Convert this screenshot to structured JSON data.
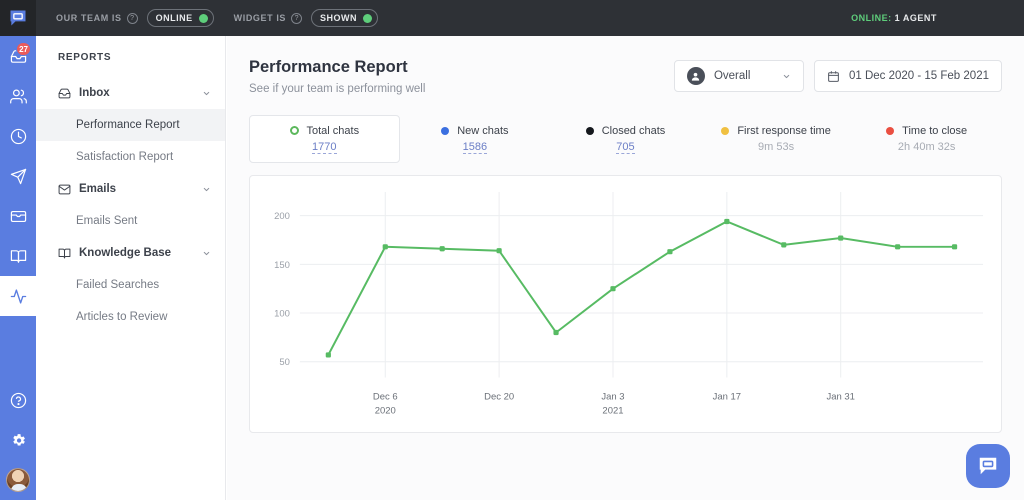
{
  "topbar": {
    "team_label": "OUR TEAM IS",
    "team_status": "ONLINE",
    "widget_label": "WIDGET IS",
    "widget_status": "SHOWN",
    "online_text": "ONLINE:",
    "agent_text": "1 AGENT",
    "help_glyph": "?",
    "online_color": "#5ece7b"
  },
  "rail": {
    "inbox_badge": "27",
    "items": [
      {
        "icon": "inbox-icon"
      },
      {
        "icon": "users-icon"
      },
      {
        "icon": "clock-icon"
      },
      {
        "icon": "paper-plane-icon"
      },
      {
        "icon": "archive-icon"
      },
      {
        "icon": "book-icon"
      },
      {
        "icon": "activity-icon"
      }
    ],
    "bottom": [
      {
        "icon": "help-circle-icon"
      },
      {
        "icon": "gear-icon"
      },
      {
        "icon": "avatar"
      }
    ]
  },
  "sidebar": {
    "title": "REPORTS",
    "groups": [
      {
        "label": "Inbox",
        "icon": "inbox-icon",
        "chevron": "chevron-down-icon",
        "items": [
          {
            "label": "Performance Report",
            "active": true
          },
          {
            "label": "Satisfaction Report",
            "active": false
          }
        ]
      },
      {
        "label": "Emails",
        "icon": "envelope-icon",
        "chevron": "chevron-down-icon",
        "items": [
          {
            "label": "Emails Sent",
            "active": false
          }
        ]
      },
      {
        "label": "Knowledge Base",
        "icon": "book-icon",
        "chevron": "chevron-down-icon",
        "items": [
          {
            "label": "Failed Searches",
            "active": false
          },
          {
            "label": "Articles to Review",
            "active": false
          }
        ]
      }
    ]
  },
  "header": {
    "title": "Performance Report",
    "subtitle": "See if your team is performing well",
    "scope_value": "Overall",
    "date_range": "01 Dec 2020 - 15 Feb 2021"
  },
  "metrics": [
    {
      "label": "Total chats",
      "value": "1770",
      "color": "#5cb85c",
      "active": true,
      "link": true,
      "marker": "ring"
    },
    {
      "label": "New chats",
      "value": "1586",
      "color": "#3b6fe0",
      "active": false,
      "link": true,
      "marker": "dot"
    },
    {
      "label": "Closed chats",
      "value": "705",
      "color": "#15181d",
      "active": false,
      "link": true,
      "marker": "dot"
    },
    {
      "label": "First response time",
      "value": "9m 53s",
      "color": "#f0c041",
      "active": false,
      "link": false,
      "marker": "dot"
    },
    {
      "label": "Time to close",
      "value": "2h 40m 32s",
      "color": "#ea4f41",
      "active": false,
      "link": false,
      "marker": "dot"
    }
  ],
  "chart_data": {
    "type": "line",
    "title": "",
    "xlabel": "",
    "ylabel": "",
    "ylim": [
      40,
      210
    ],
    "yticks": [
      50,
      100,
      150,
      200
    ],
    "ytick_labels": [
      "50",
      "100",
      "150",
      "200"
    ],
    "grid": true,
    "legend_position": "top",
    "series_color": "#57bb63",
    "xticks": [
      "Dec 6",
      "Dec 20",
      "Jan 3",
      "Jan 17",
      "Jan 31"
    ],
    "xtick_sublabels": [
      "2020",
      "",
      "2021",
      "",
      ""
    ],
    "x": [
      "Nov 29",
      "Dec 6",
      "Dec 13",
      "Dec 20",
      "Dec 27",
      "Jan 3",
      "Jan 10",
      "Jan 17",
      "Jan 24",
      "Jan 31",
      "Feb 7",
      "Feb 14"
    ],
    "series": [
      {
        "name": "Total chats",
        "values": [
          57,
          168,
          166,
          164,
          80,
          125,
          163,
          194,
          170,
          177,
          168,
          168
        ]
      }
    ]
  },
  "chat_widget": {
    "icon": "chat-bubble-icon"
  }
}
